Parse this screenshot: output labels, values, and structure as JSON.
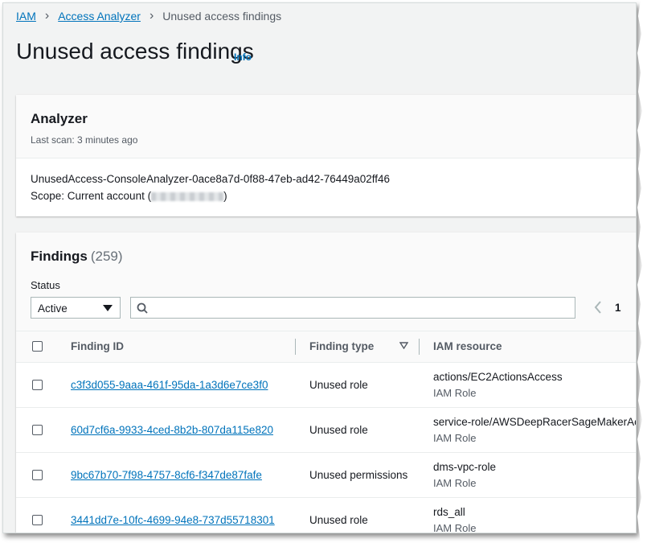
{
  "breadcrumb": {
    "items": [
      "IAM",
      "Access Analyzer"
    ],
    "current": "Unused access findings"
  },
  "page": {
    "title": "Unused access findings",
    "info": "Info"
  },
  "analyzer": {
    "heading": "Analyzer",
    "last_scan": "Last scan: 3 minutes ago",
    "name": "UnusedAccess-ConsoleAnalyzer-0ace8a7d-0f88-47eb-ad42-76449a02ff46",
    "scope_prefix": "Scope: Current account (",
    "scope_suffix": ")"
  },
  "findings": {
    "heading": "Findings",
    "count": "(259)",
    "status_label": "Status",
    "status_value": "Active",
    "page_number": "1",
    "columns": [
      "Finding ID",
      "Finding type",
      "IAM resource"
    ],
    "rows": [
      {
        "id": "c3f3d055-9aaa-461f-95da-1a3d6e7ce3f0",
        "type": "Unused role",
        "resource": "actions/EC2ActionsAccess",
        "resource_type": "IAM Role"
      },
      {
        "id": "60d7cf6a-9933-4ced-8b2b-807da115e820",
        "type": "Unused role",
        "resource": "service-role/AWSDeepRacerSageMakerAccess",
        "resource_type": "IAM Role"
      },
      {
        "id": "9bc67b70-7f98-4757-8cf6-f347de87fafe",
        "type": "Unused permissions",
        "resource": "dms-vpc-role",
        "resource_type": "IAM Role"
      },
      {
        "id": "3441dd7e-10fc-4699-94e8-737d55718301",
        "type": "Unused role",
        "resource": "rds_all",
        "resource_type": "IAM Role"
      }
    ]
  },
  "colors": {
    "link": "#0073bb",
    "background": "#f2f3f3",
    "text": "#16191f",
    "muted": "#545b64"
  },
  "icons": {
    "search": "search-icon",
    "caret": "caret-down-icon",
    "filter": "sort-filter-icon",
    "prev": "chevron-left-icon"
  }
}
